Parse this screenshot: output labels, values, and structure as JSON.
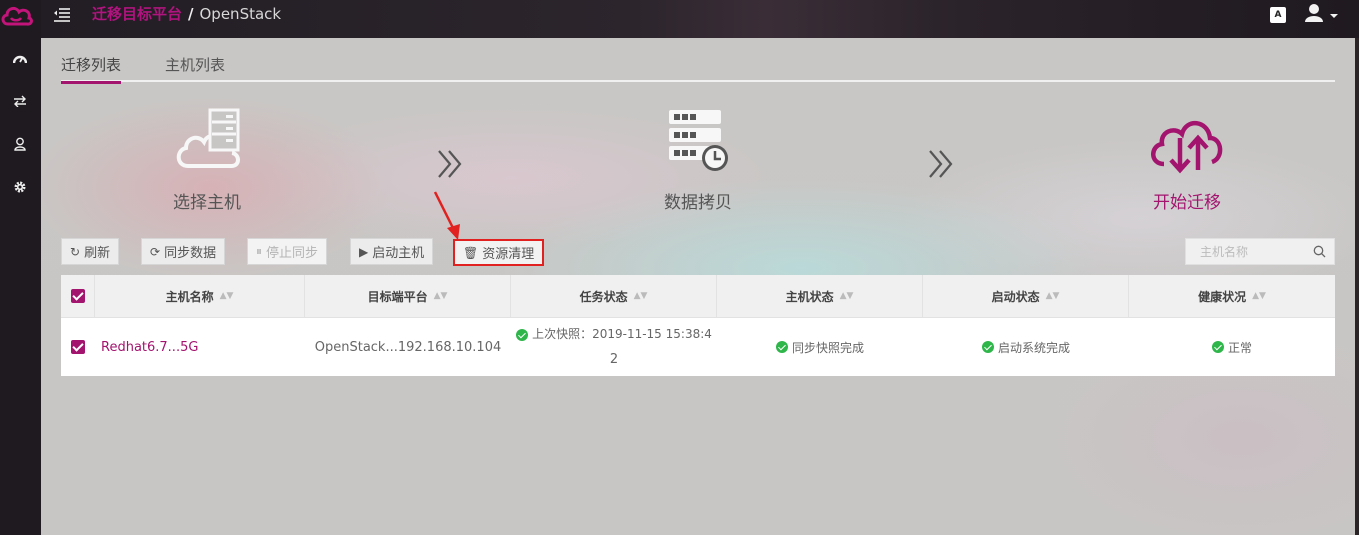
{
  "header": {
    "breadcrumb_app": "迁移目标平台",
    "breadcrumb_sep": "/",
    "breadcrumb_page": "OpenStack",
    "lang_label": "A"
  },
  "sidebar": {
    "items": [
      {
        "icon": "dashboard-icon"
      },
      {
        "icon": "transfer-icon"
      },
      {
        "icon": "user-icon"
      },
      {
        "icon": "gear-icon"
      }
    ]
  },
  "tabs": [
    {
      "label": "迁移列表",
      "active": true
    },
    {
      "label": "主机列表",
      "active": false
    }
  ],
  "steps": [
    {
      "label": "选择主机",
      "icon": "cloud-server-icon"
    },
    {
      "label": "数据拷贝",
      "icon": "server-clock-icon"
    },
    {
      "label": "开始迁移",
      "icon": "cloud-transfer-icon"
    }
  ],
  "toolbar": {
    "refresh": "刷新",
    "sync_data": "同步数据",
    "stop_sync": "停止同步",
    "start_host": "启动主机",
    "cleanup": "资源清理"
  },
  "search": {
    "placeholder": "主机名称"
  },
  "table": {
    "columns": [
      "主机名称",
      "目标端平台",
      "任务状态",
      "主机状态",
      "启动状态",
      "健康状况"
    ],
    "rows": [
      {
        "checked": true,
        "host_name": "Redhat6.7...5G",
        "target_platform": "OpenStack...192.168.10.104",
        "task_status_line1": "上次快照：2019-11-15 15:38:4",
        "task_status_line2": "2",
        "host_status": "同步快照完成",
        "boot_status": "启动系统完成",
        "health": "正常"
      }
    ]
  },
  "colors": {
    "accent": "#a3146f",
    "success": "#2fb64b",
    "highlight": "#e1211f"
  }
}
